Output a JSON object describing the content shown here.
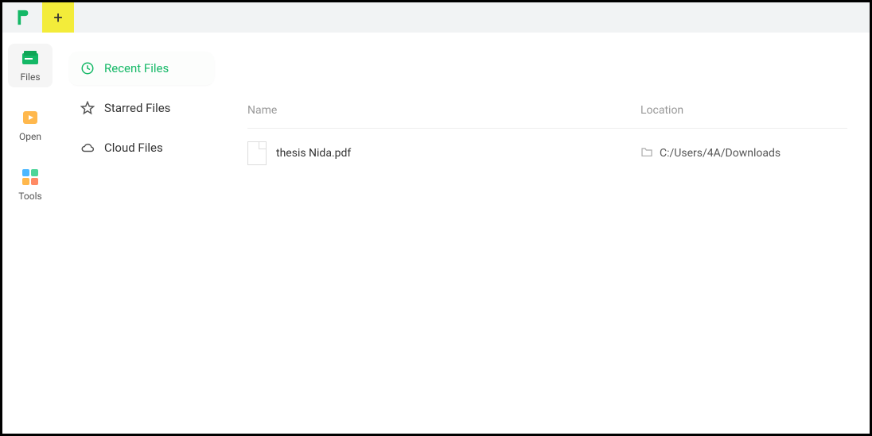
{
  "titlebar": {
    "plus_label": "+"
  },
  "rail": {
    "files": "Files",
    "open": "Open",
    "tools": "Tools"
  },
  "sidebar": {
    "recent": "Recent Files",
    "starred": "Starred Files",
    "cloud": "Cloud Files"
  },
  "table": {
    "header_name": "Name",
    "header_location": "Location"
  },
  "files": [
    {
      "name": "thesis Nida.pdf",
      "location": "C:/Users/4A/Downloads"
    }
  ]
}
